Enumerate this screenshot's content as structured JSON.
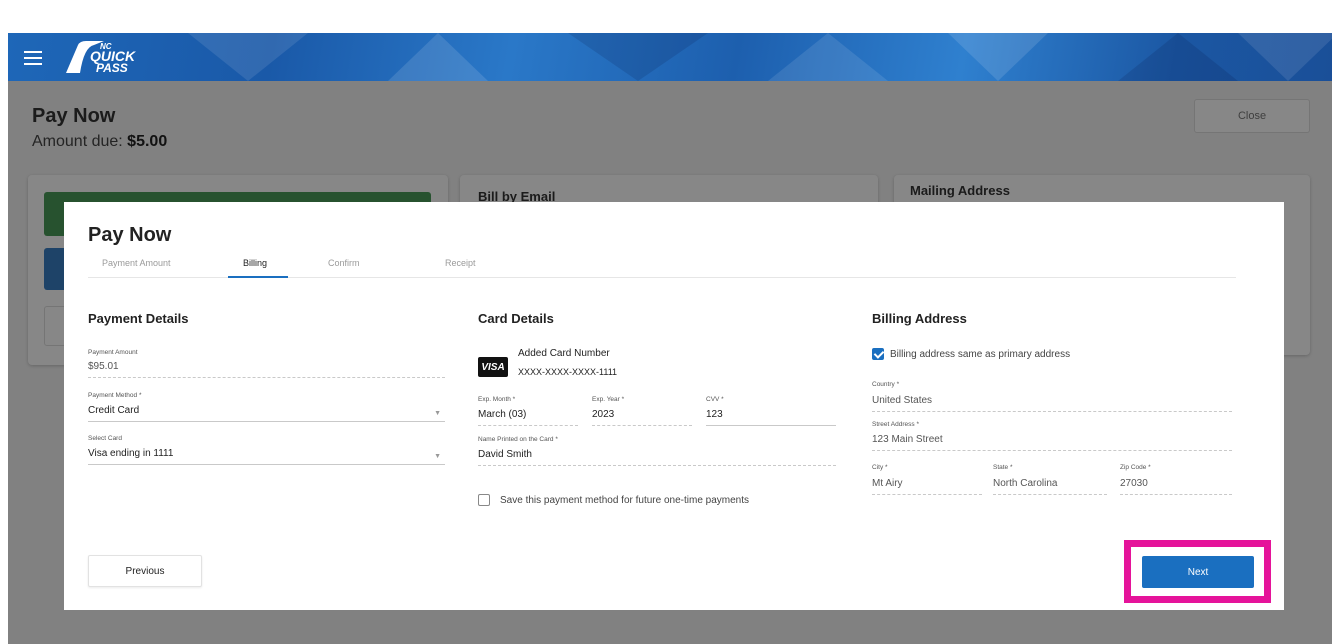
{
  "header": {
    "logo_top": "NC",
    "logo_mid": "QUICK",
    "logo_bottom": "PASS"
  },
  "page": {
    "title": "Pay Now",
    "amount_label": "Amount due: ",
    "amount_value": "$5.00",
    "close_label": "Close"
  },
  "background_cards": {
    "bill_by_email": "Bill by Email",
    "mailing_address": "Mailing Address"
  },
  "modal": {
    "title": "Pay Now",
    "tabs": [
      {
        "label": "Payment Amount"
      },
      {
        "label": "Billing"
      },
      {
        "label": "Confirm"
      },
      {
        "label": "Receipt"
      }
    ],
    "payment_details": {
      "title": "Payment Details",
      "payment_amount_label": "Payment Amount",
      "payment_amount_value": "$95.01",
      "payment_method_label": "Payment Method *",
      "payment_method_value": "Credit Card",
      "select_card_label": "Select Card",
      "select_card_value": "Visa ending in 1111"
    },
    "card_details": {
      "title": "Card Details",
      "brand": "VISA",
      "added_card_label": "Added Card Number",
      "card_number": "XXXX-XXXX-XXXX-1111",
      "exp_month_label": "Exp. Month *",
      "exp_month_value": "March (03)",
      "exp_year_label": "Exp. Year *",
      "exp_year_value": "2023",
      "cvv_label": "CVV *",
      "cvv_value": "123",
      "name_label": "Name Printed on the Card *",
      "name_value": "David Smith",
      "save_method_label": "Save this payment method for future one-time payments"
    },
    "billing_address": {
      "title": "Billing Address",
      "same_as_primary_label": "Billing address same as primary address",
      "country_label": "Country *",
      "country_value": "United States",
      "street_label": "Street Address *",
      "street_value": "123 Main Street",
      "city_label": "City *",
      "city_value": "Mt Airy",
      "state_label": "State *",
      "state_value": "North Carolina",
      "zip_label": "Zip Code *",
      "zip_value": "27030"
    },
    "previous_label": "Previous",
    "next_label": "Next"
  },
  "colors": {
    "accent": "#1a6fc0",
    "highlight": "#e5139a",
    "header": "#1e67b8"
  }
}
